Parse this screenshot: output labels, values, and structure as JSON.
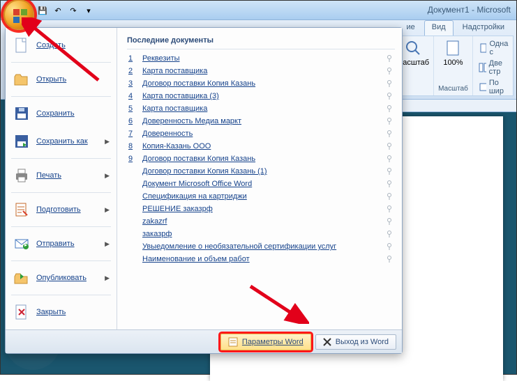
{
  "title": "Документ1 - Microsoft",
  "qat": {
    "save": "💾",
    "undo": "↶",
    "redo": "↷",
    "dd": "▾"
  },
  "tabs": {
    "hidden": "ие",
    "view": "Вид",
    "addins": "Надстройки"
  },
  "ribbon": {
    "zoom_btn": "Масштаб",
    "zoom_pct": "100%",
    "one_page": "Одна с",
    "two_page": "Две стр",
    "width": "По шир",
    "group": "Масштаб"
  },
  "menu": {
    "new": "Создать",
    "open": "Открыть",
    "save": "Сохранить",
    "saveas": "Сохранить как",
    "print": "Печать",
    "prepare": "Подготовить",
    "send": "Отправить",
    "publish": "Опубликовать",
    "close": "Закрыть"
  },
  "recent_header": "Последние документы",
  "recent": [
    {
      "n": "1",
      "t": "Реквезиты"
    },
    {
      "n": "2",
      "t": "Карта поставщика"
    },
    {
      "n": "3",
      "t": "Договор поставки Копия Казань"
    },
    {
      "n": "4",
      "t": "Карта поставщика (3)"
    },
    {
      "n": "5",
      "t": "Карта поставщика"
    },
    {
      "n": "6",
      "t": "Доверенность Медиа маркт"
    },
    {
      "n": "7",
      "t": "Доверенность"
    },
    {
      "n": "8",
      "t": "Копия-Казань ООО"
    },
    {
      "n": "9",
      "t": "Договор поставки Копия Казань"
    },
    {
      "n": "",
      "t": "Договор поставки Копия Казань (1)"
    },
    {
      "n": "",
      "t": "Документ Microsoft Office Word"
    },
    {
      "n": "",
      "t": "Спецификация на картриджи"
    },
    {
      "n": "",
      "t": "РЕШЕНИЕ   заказрф"
    },
    {
      "n": "",
      "t": "zakazrf"
    },
    {
      "n": "",
      "t": "заказрф"
    },
    {
      "n": "",
      "t": "Увыедомление о необязательной сертификации услуг"
    },
    {
      "n": "",
      "t": "Наименование и объем работ"
    }
  ],
  "footer": {
    "options": "Параметры Word",
    "exit": "Выход из Word"
  }
}
